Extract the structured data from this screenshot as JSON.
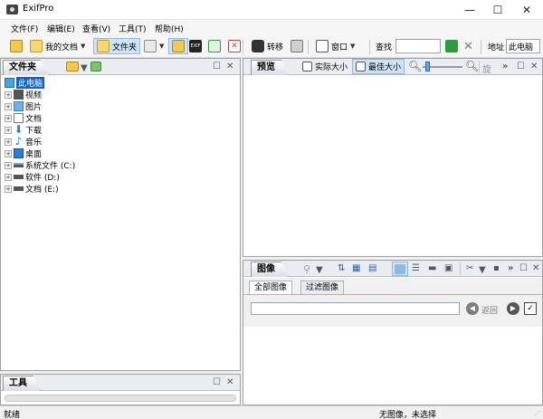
{
  "window": {
    "title": "ExifPro",
    "min_glyph": "—",
    "max_glyph": "☐",
    "close_glyph": "✕"
  },
  "menu": [
    "文件(F)",
    "编辑(E)",
    "查看(V)",
    "工具(T)",
    "帮助(H)"
  ],
  "toolbar": {
    "my_documents": "我的文档",
    "folders": "文件夹",
    "exif_badge": "EXIF",
    "transfer": "转移",
    "window": "窗口",
    "find_label": "查找",
    "find_value": "",
    "address_label": "地址",
    "address_value": "此电脑"
  },
  "folder_pane": {
    "title": "文件夹",
    "tree": [
      {
        "label": "此电脑",
        "selected": true,
        "icon": "computer-icon"
      },
      {
        "label": "视频",
        "icon": "video-folder-icon"
      },
      {
        "label": "图片",
        "icon": "pictures-folder-icon"
      },
      {
        "label": "文档",
        "icon": "documents-folder-icon"
      },
      {
        "label": "下载",
        "icon": "download-folder-icon"
      },
      {
        "label": "音乐",
        "icon": "music-folder-icon"
      },
      {
        "label": "桌面",
        "icon": "desktop-folder-icon"
      },
      {
        "label": "系统文件 (C:)",
        "icon": "drive-icon"
      },
      {
        "label": "软件 (D:)",
        "icon": "drive-icon"
      },
      {
        "label": "文档 (E:)",
        "icon": "drive-icon"
      }
    ]
  },
  "preview_pane": {
    "title": "预览",
    "actual_size": "实际大小",
    "best_fit": "最佳大小",
    "more": "旋"
  },
  "images_pane": {
    "title": "图像",
    "tabs": [
      "全部图像",
      "过滤图像"
    ],
    "filter_value": "",
    "back_label": "返回"
  },
  "tools_pane": {
    "title": "工具"
  },
  "status": {
    "left": "就绪",
    "right": "无图像，未选择"
  },
  "colors": {
    "accent": "#0a64d6",
    "green": "#2e9b3e",
    "red": "#d23c3c"
  }
}
